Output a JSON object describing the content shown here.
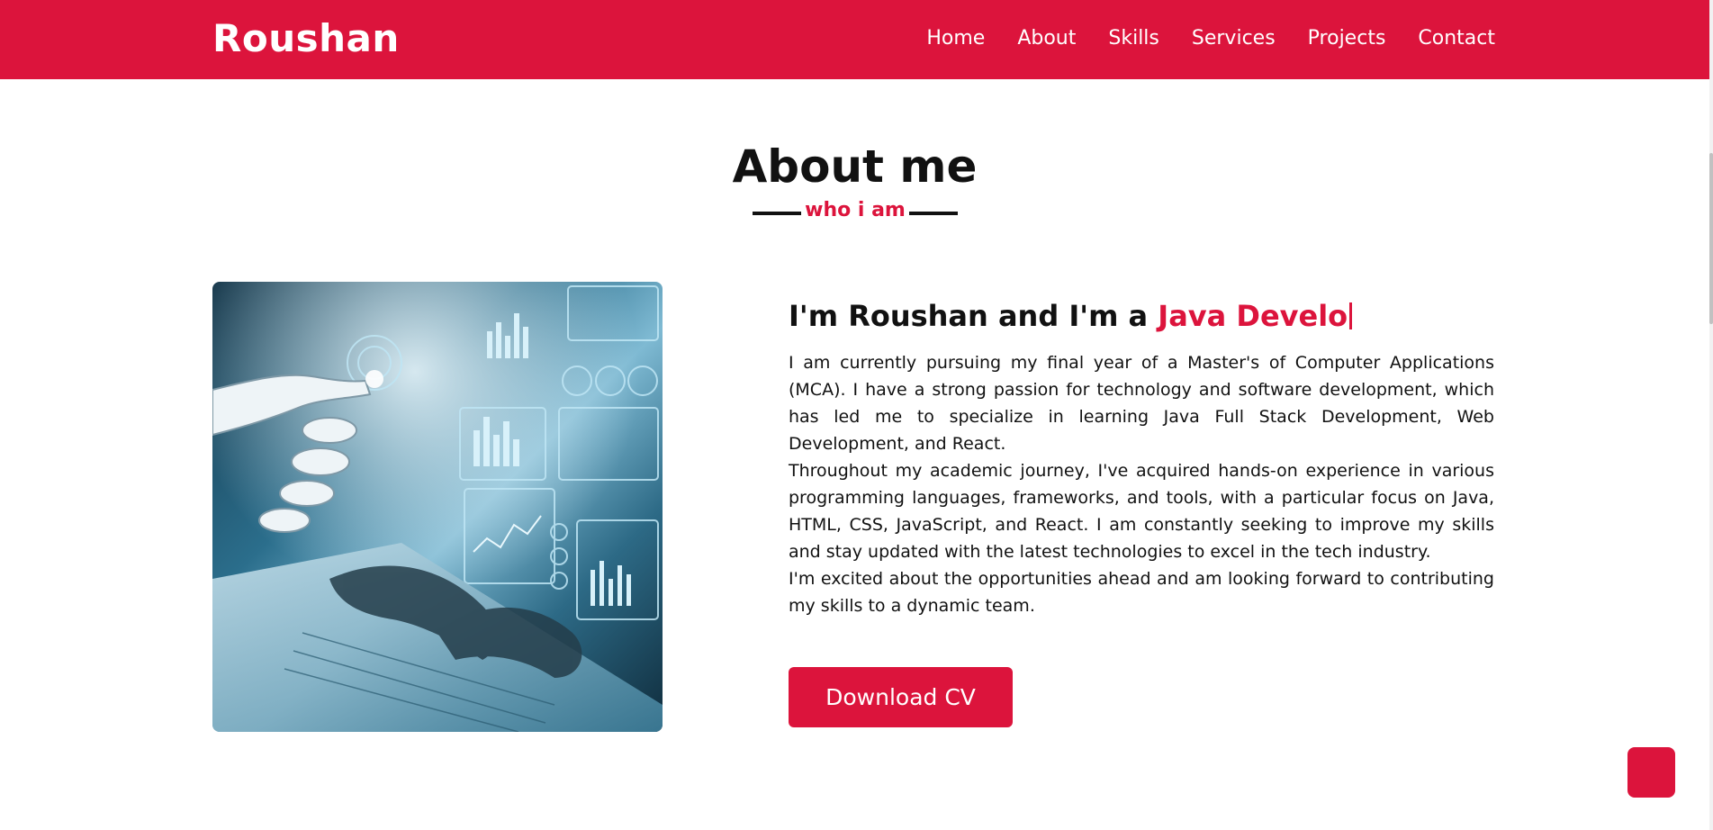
{
  "navbar": {
    "logo": "Roushan",
    "items": [
      {
        "label": "Home"
      },
      {
        "label": "About"
      },
      {
        "label": "Skills"
      },
      {
        "label": "Services"
      },
      {
        "label": "Projects"
      },
      {
        "label": "Contact"
      }
    ]
  },
  "about": {
    "title": "About me",
    "subtitle": "who i am",
    "heading_prefix": "I'm Roushan and I'm a ",
    "heading_typed": "Java Develo",
    "paragraphs": [
      "I am currently pursuing my final year of a Master's of Computer Applications (MCA). I have a strong passion for technology and software development, which has led me to specialize in learning Java Full Stack Development, Web Development, and React.",
      "Throughout my academic journey, I've acquired hands-on experience in various programming languages, frameworks, and tools, with a particular focus on Java, HTML, CSS, JavaScript, and React. I am constantly seeking to improve my skills and stay updated with the latest technologies to excel in the tech industry.",
      "I'm excited about the opportunities ahead and am looking forward to contributing my skills to a dynamic team."
    ],
    "button_label": "Download CV"
  },
  "colors": {
    "accent": "#dc143c",
    "text": "#111111",
    "background": "#ffffff"
  }
}
